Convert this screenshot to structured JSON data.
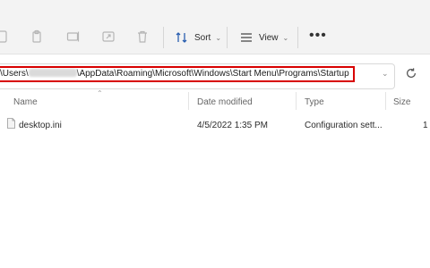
{
  "toolbar": {
    "sort_label": "Sort",
    "view_label": "View",
    "more_label": "•••"
  },
  "address": {
    "prefix": "\\Users\\",
    "suffix": "\\AppData\\Roaming\\Microsoft\\Windows\\Start Menu\\Programs\\Startup"
  },
  "columns": {
    "name": "Name",
    "date": "Date modified",
    "type": "Type",
    "size": "Size"
  },
  "files": [
    {
      "name": "desktop.ini",
      "date": "4/5/2022 1:35 PM",
      "type": "Configuration sett...",
      "size": "1"
    }
  ],
  "colors": {
    "highlight": "#d80000",
    "toolbar_bg": "#f3f3f3"
  }
}
